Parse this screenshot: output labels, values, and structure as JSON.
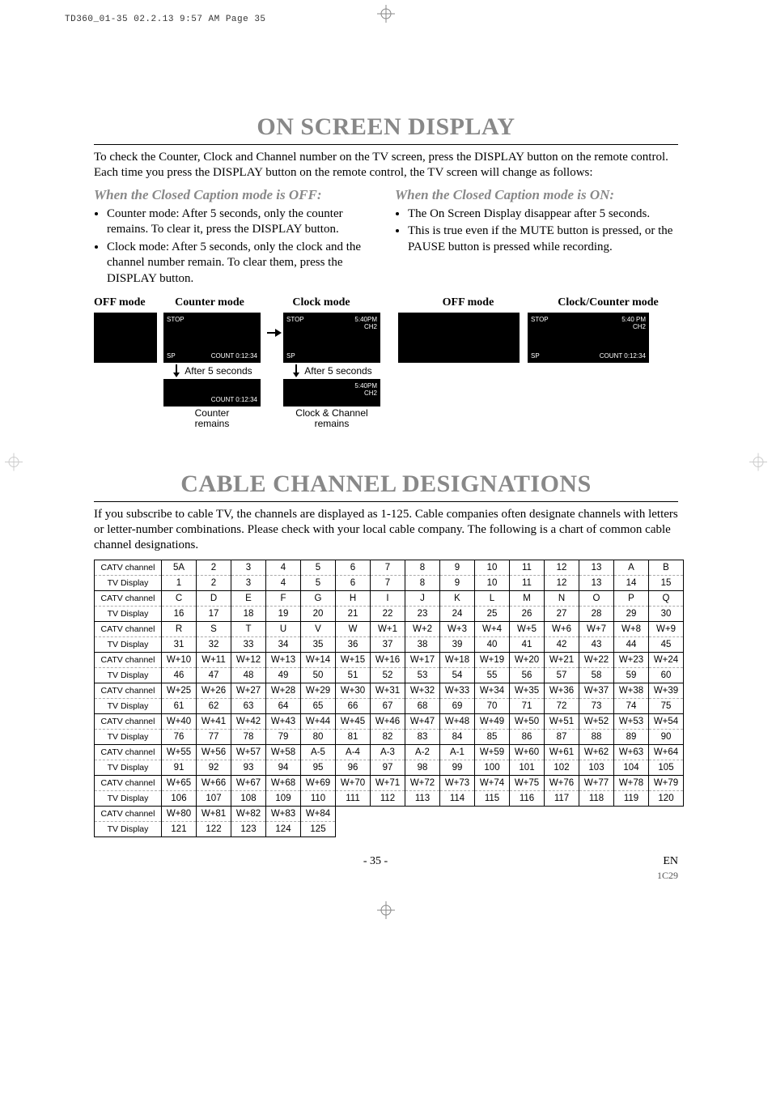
{
  "slug": "TD360_01-35  02.2.13  9:57 AM  Page 35",
  "osd": {
    "title": "ON SCREEN DISPLAY",
    "intro": "To check the Counter, Clock and Channel number on the TV screen, press the DISPLAY button on the remote control. Each time you press the DISPLAY button on the remote control, the TV screen will change as follows:",
    "off_head": "When the Closed Caption mode is OFF:",
    "off_bullets": [
      "Counter mode: After 5 seconds, only the counter remains. To clear it, press the DISPLAY button.",
      "Clock mode: After 5 seconds, only the clock and the channel number remain. To clear them, press the DISPLAY button."
    ],
    "on_head": "When the Closed Caption mode is ON:",
    "on_bullets": [
      "The On Screen Display disappear after 5 seconds.",
      "This is true even if the MUTE button is pressed, or the PAUSE button is pressed while recording."
    ],
    "labels": {
      "off_mode": "OFF mode",
      "counter_mode": "Counter mode",
      "clock_mode": "Clock mode",
      "clock_counter_mode": "Clock/Counter mode",
      "after5": "After 5 seconds",
      "counter_remains": "Counter\nremains",
      "clock_channel_remains": "Clock & Channel\nremains"
    },
    "tv": {
      "stop": "STOP",
      "time": "5:40PM",
      "time_sp": "5:40 PM",
      "ch": "CH2",
      "sp": "SP",
      "count": "COUNT  0:12:34"
    }
  },
  "ccd": {
    "title": "CABLE CHANNEL DESIGNATIONS",
    "intro": "If you subscribe to cable TV, the channels are displayed as 1-125. Cable companies often designate channels with letters or letter-number combinations. Please check with your local cable company. The following is a chart of common cable channel designations.",
    "rowlabels": {
      "catv": "CATV channel",
      "tv": "TV Display"
    },
    "pairs": [
      {
        "catv": [
          "5A",
          "2",
          "3",
          "4",
          "5",
          "6",
          "7",
          "8",
          "9",
          "10",
          "11",
          "12",
          "13",
          "A",
          "B"
        ],
        "tv": [
          "1",
          "2",
          "3",
          "4",
          "5",
          "6",
          "7",
          "8",
          "9",
          "10",
          "11",
          "12",
          "13",
          "14",
          "15"
        ]
      },
      {
        "catv": [
          "C",
          "D",
          "E",
          "F",
          "G",
          "H",
          "I",
          "J",
          "K",
          "L",
          "M",
          "N",
          "O",
          "P",
          "Q"
        ],
        "tv": [
          "16",
          "17",
          "18",
          "19",
          "20",
          "21",
          "22",
          "23",
          "24",
          "25",
          "26",
          "27",
          "28",
          "29",
          "30"
        ]
      },
      {
        "catv": [
          "R",
          "S",
          "T",
          "U",
          "V",
          "W",
          "W+1",
          "W+2",
          "W+3",
          "W+4",
          "W+5",
          "W+6",
          "W+7",
          "W+8",
          "W+9"
        ],
        "tv": [
          "31",
          "32",
          "33",
          "34",
          "35",
          "36",
          "37",
          "38",
          "39",
          "40",
          "41",
          "42",
          "43",
          "44",
          "45"
        ]
      },
      {
        "catv": [
          "W+10",
          "W+11",
          "W+12",
          "W+13",
          "W+14",
          "W+15",
          "W+16",
          "W+17",
          "W+18",
          "W+19",
          "W+20",
          "W+21",
          "W+22",
          "W+23",
          "W+24"
        ],
        "tv": [
          "46",
          "47",
          "48",
          "49",
          "50",
          "51",
          "52",
          "53",
          "54",
          "55",
          "56",
          "57",
          "58",
          "59",
          "60"
        ]
      },
      {
        "catv": [
          "W+25",
          "W+26",
          "W+27",
          "W+28",
          "W+29",
          "W+30",
          "W+31",
          "W+32",
          "W+33",
          "W+34",
          "W+35",
          "W+36",
          "W+37",
          "W+38",
          "W+39"
        ],
        "tv": [
          "61",
          "62",
          "63",
          "64",
          "65",
          "66",
          "67",
          "68",
          "69",
          "70",
          "71",
          "72",
          "73",
          "74",
          "75"
        ]
      },
      {
        "catv": [
          "W+40",
          "W+41",
          "W+42",
          "W+43",
          "W+44",
          "W+45",
          "W+46",
          "W+47",
          "W+48",
          "W+49",
          "W+50",
          "W+51",
          "W+52",
          "W+53",
          "W+54"
        ],
        "tv": [
          "76",
          "77",
          "78",
          "79",
          "80",
          "81",
          "82",
          "83",
          "84",
          "85",
          "86",
          "87",
          "88",
          "89",
          "90"
        ]
      },
      {
        "catv": [
          "W+55",
          "W+56",
          "W+57",
          "W+58",
          "A-5",
          "A-4",
          "A-3",
          "A-2",
          "A-1",
          "W+59",
          "W+60",
          "W+61",
          "W+62",
          "W+63",
          "W+64"
        ],
        "tv": [
          "91",
          "92",
          "93",
          "94",
          "95",
          "96",
          "97",
          "98",
          "99",
          "100",
          "101",
          "102",
          "103",
          "104",
          "105"
        ]
      },
      {
        "catv": [
          "W+65",
          "W+66",
          "W+67",
          "W+68",
          "W+69",
          "W+70",
          "W+71",
          "W+72",
          "W+73",
          "W+74",
          "W+75",
          "W+76",
          "W+77",
          "W+78",
          "W+79"
        ],
        "tv": [
          "106",
          "107",
          "108",
          "109",
          "110",
          "111",
          "112",
          "113",
          "114",
          "115",
          "116",
          "117",
          "118",
          "119",
          "120"
        ]
      },
      {
        "catv": [
          "W+80",
          "W+81",
          "W+82",
          "W+83",
          "W+84",
          "",
          "",
          "",
          "",
          "",
          "",
          "",
          "",
          "",
          ""
        ],
        "tv": [
          "121",
          "122",
          "123",
          "124",
          "125",
          "",
          "",
          "",
          "",
          "",
          "",
          "",
          "",
          "",
          ""
        ]
      }
    ]
  },
  "footer": {
    "page": "- 35 -",
    "lang": "EN",
    "code": "1C29"
  }
}
